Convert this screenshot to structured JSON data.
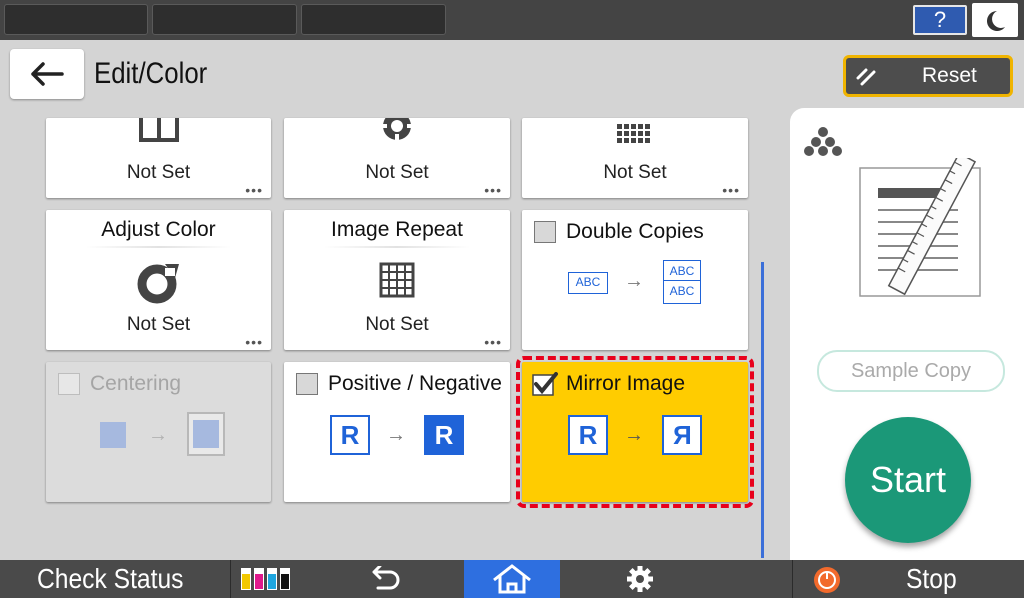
{
  "header": {
    "title": "Edit/Color",
    "help_label": "?",
    "reset_label": "Reset"
  },
  "tiles_row1": [
    {
      "status": "Not Set",
      "icon": "split-page-icon"
    },
    {
      "status": "Not Set",
      "icon": "gear-ring-icon"
    },
    {
      "status": "Not Set",
      "icon": "dot-grid-icon"
    }
  ],
  "tiles_row2": {
    "adjust_color": {
      "title": "Adjust Color",
      "status": "Not Set"
    },
    "image_repeat": {
      "title": "Image Repeat",
      "status": "Not Set"
    },
    "double_copies": {
      "title": "Double Copies",
      "abc": "ABC",
      "checked": false
    }
  },
  "tiles_row3": {
    "centering": {
      "title": "Centering",
      "enabled": false,
      "checked": false
    },
    "positive_negative": {
      "title": "Positive / Negative",
      "letter": "R",
      "checked": false
    },
    "mirror_image": {
      "title": "Mirror Image",
      "letter": "R",
      "checked": true
    }
  },
  "more_dots": "•••",
  "right_panel": {
    "sample_copy_label": "Sample Copy",
    "start_label": "Start"
  },
  "bottom_bar": {
    "check_status_label": "Check Status",
    "stop_label": "Stop"
  },
  "colors": {
    "accent_blue": "#1f63d8",
    "selected_yellow": "#ffcc00",
    "start_green": "#1b9878",
    "reset_border": "#f0b400",
    "selection_dash": "#e8001b"
  }
}
